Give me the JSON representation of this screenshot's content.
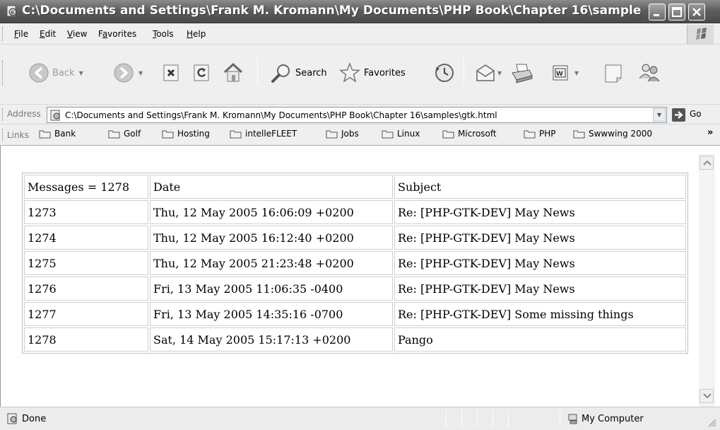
{
  "window": {
    "title": "C:\\Documents and Settings\\Frank M. Kromann\\My Documents\\PHP Book\\Chapter 16\\sample..."
  },
  "menu": {
    "items": [
      {
        "label": "File",
        "accel": "F",
        "rest": "ile"
      },
      {
        "label": "Edit",
        "accel": "E",
        "rest": "dit"
      },
      {
        "label": "View",
        "accel": "V",
        "rest": "iew"
      },
      {
        "label": "Favorites",
        "pre": "F",
        "accel": "a",
        "rest": "vorites"
      },
      {
        "label": "Tools",
        "accel": "T",
        "rest": "ools"
      },
      {
        "label": "Help",
        "accel": "H",
        "rest": "elp"
      }
    ]
  },
  "toolbar": {
    "back_label": "Back",
    "search_label": "Search",
    "favorites_label": "Favorites"
  },
  "address": {
    "label": "Address",
    "value": "C:\\Documents and Settings\\Frank M. Kromann\\My Documents\\PHP Book\\Chapter 16\\samples\\gtk.html",
    "go_label": "Go"
  },
  "links": {
    "label": "Links",
    "items": [
      "Bank",
      "Golf",
      "Hosting",
      "intelleFLEET",
      "Jobs",
      "Linux",
      "Microsoft",
      "PHP",
      "Swwwing 2000"
    ],
    "more": "»"
  },
  "table": {
    "header": [
      "Messages = 1278",
      "Date",
      "Subject"
    ],
    "rows": [
      [
        "1273",
        "Thu, 12 May 2005 16:06:09 +0200",
        "Re: [PHP-GTK-DEV] May News"
      ],
      [
        "1274",
        "Thu, 12 May 2005 16:12:40 +0200",
        "Re: [PHP-GTK-DEV] May News"
      ],
      [
        "1275",
        "Thu, 12 May 2005 21:23:48 +0200",
        "Re: [PHP-GTK-DEV] May News"
      ],
      [
        "1276",
        "Fri, 13 May 2005 11:06:35 -0400",
        "Re: [PHP-GTK-DEV] May News"
      ],
      [
        "1277",
        "Fri, 13 May 2005 14:35:16 -0700",
        "Re: [PHP-GTK-DEV] Some missing things"
      ],
      [
        "1278",
        "Sat, 14 May 2005 15:17:13 +0200",
        "Pango"
      ]
    ]
  },
  "status": {
    "text": "Done",
    "zone": "My Computer"
  }
}
